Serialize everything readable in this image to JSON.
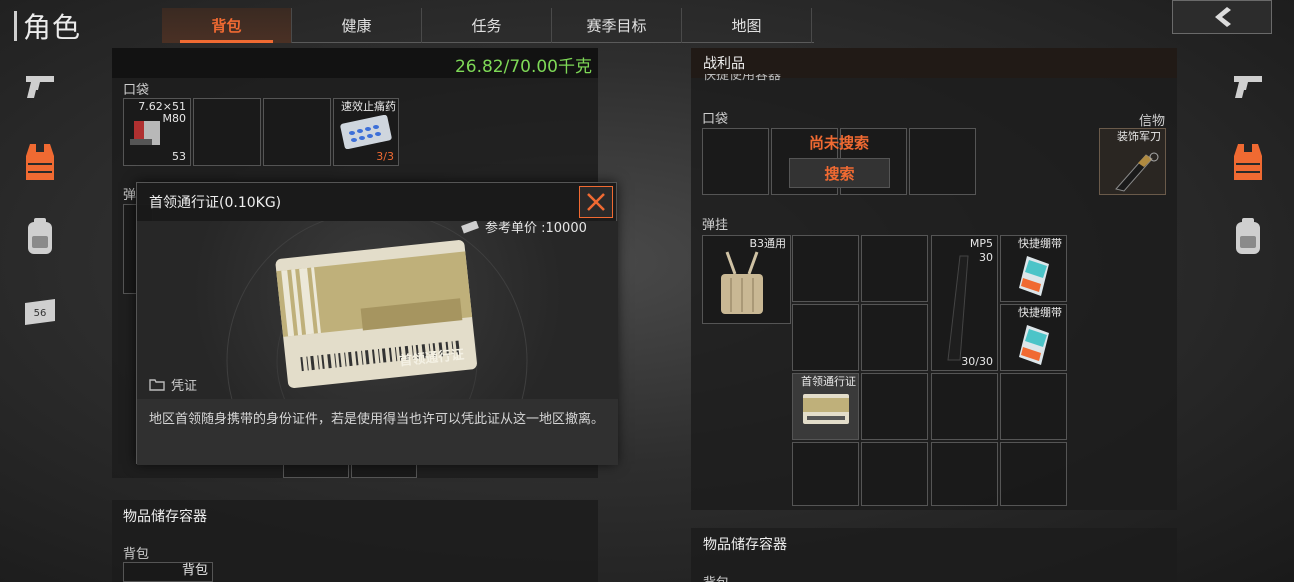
{
  "header": {
    "title": "角色",
    "tabs": [
      {
        "label": "背包",
        "active": true
      },
      {
        "label": "健康",
        "active": false
      },
      {
        "label": "任务",
        "active": false
      },
      {
        "label": "赛季目标",
        "active": false
      },
      {
        "label": "地图",
        "active": false
      }
    ]
  },
  "left_panel": {
    "weight": "26.82/70.00千克",
    "pocket_label": "口袋",
    "pocket_items": [
      {
        "name": "7.62×51\nM80",
        "count": "53"
      },
      {
        "name": "",
        "count": ""
      },
      {
        "name": "",
        "count": ""
      },
      {
        "name": "速效止痛药",
        "count": "3/3"
      }
    ],
    "rig_label_partial": "弹",
    "storage_header": "物品储存容器",
    "backpack_label": "背包",
    "backpack_slot": "背包"
  },
  "popup": {
    "title": "首领通行证(0.10KG)",
    "price_label": "参考单价 :10000",
    "category": "凭证",
    "card_text": "首领通行证",
    "description": "地区首领随身携带的身份证件，若是使用得当也许可以凭此证从这一地区撤离。"
  },
  "right_panel": {
    "header": "战利品",
    "partial_label": "快捷使用容器",
    "pocket_label": "口袋",
    "not_searched": "尚未搜索",
    "search_button": "搜索",
    "keepsake_label": "信物",
    "keepsake_item": "装饰军刀",
    "rig_label": "弹挂",
    "rig_items": {
      "rig": "B3通用",
      "magazine": "MP5",
      "magazine_top_count": "30",
      "magazine_count": "30/30",
      "bandage1": "快捷绷带",
      "bandage2": "快捷绷带",
      "pass": "首领通行证"
    },
    "storage_header": "物品储存容器",
    "backpack_label": "背包"
  },
  "colors": {
    "accent": "#f06a32",
    "weight": "#7ed957"
  },
  "icons": [
    "pistol-icon",
    "vest-icon",
    "backpack-icon",
    "armband-icon",
    "close-icon",
    "back-chevron-icon",
    "folder-icon",
    "coin-icon"
  ]
}
